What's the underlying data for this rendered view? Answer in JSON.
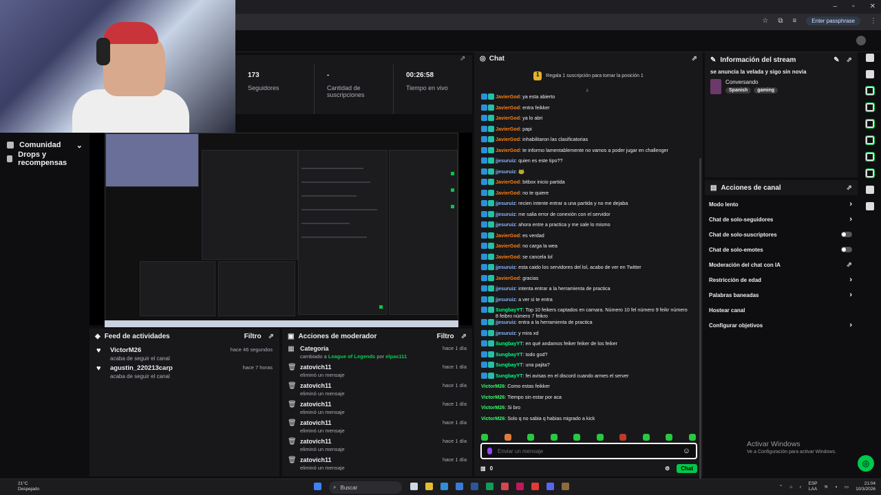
{
  "browser": {
    "passphrase_label": "Enter passphrase",
    "win_min": "–",
    "win_max": "▫",
    "win_close": "✕"
  },
  "leftnav": {
    "items": [
      {
        "label": "Comunidad"
      },
      {
        "label": "Drops y recompensas"
      }
    ]
  },
  "stats": [
    {
      "value": "173",
      "label": "Seguidores"
    },
    {
      "value": "-",
      "label": "Cantidad de suscripciones"
    },
    {
      "value": "00:26:58",
      "label": "Tiempo en vivo"
    }
  ],
  "feed": {
    "title": "Feed de actividades",
    "filter": "Filtro",
    "items": [
      {
        "name": "VictorM26",
        "sub": "acaba de seguir el canal",
        "time": "hace 46 segundos"
      },
      {
        "name": "agustin_220213carp",
        "sub": "acaba de seguir el canal",
        "time": "hace 7 horas"
      }
    ]
  },
  "modactions": {
    "title": "Acciones de moderador",
    "filter": "Filtro",
    "category": {
      "name": "Categoría",
      "pre": "cambiado a",
      "game": "League of Legends",
      "mid": "por",
      "by": "elpas111",
      "time": "hace 1 día"
    },
    "items": [
      {
        "name": "zatovich11",
        "sub": "eliminó un mensaje",
        "time": "hace 1 día"
      },
      {
        "name": "zatovich11",
        "sub": "eliminó un mensaje",
        "time": "hace 1 día"
      },
      {
        "name": "zatovich11",
        "sub": "eliminó un mensaje",
        "time": "hace 1 día"
      },
      {
        "name": "zatovich11",
        "sub": "eliminó un mensaje",
        "time": "hace 1 día"
      },
      {
        "name": "zatovich11",
        "sub": "eliminó un mensaje",
        "time": "hace 1 día"
      },
      {
        "name": "zatovich11",
        "sub": "eliminó un mensaje",
        "time": "hace 1 día"
      }
    ]
  },
  "chat": {
    "title": "Chat",
    "gift_text": "Regala 1 suscripción para tomar la posición 1",
    "gift_rank": "1",
    "input_placeholder": "Enviar un mensaje",
    "points": "0",
    "send_label": "Chat",
    "messages": [
      {
        "user": "JavierGod",
        "cls": "uJ",
        "badges": true,
        "text": ": ya esta abierto"
      },
      {
        "user": "JavierGod",
        "cls": "uJ",
        "badges": true,
        "text": ": entra feikker"
      },
      {
        "user": "JavierGod",
        "cls": "uJ",
        "badges": true,
        "text": ": ya lo abri"
      },
      {
        "user": "JavierGod",
        "cls": "uJ",
        "badges": true,
        "text": ": papi"
      },
      {
        "user": "JavierGod",
        "cls": "uJ",
        "badges": true,
        "text": ": inhabilitaron las clasificatorias"
      },
      {
        "user": "JavierGod",
        "cls": "uJ",
        "badges": true,
        "text": ": te informo lamentablemente no vamos a poder jugar en challenger"
      },
      {
        "user": "jjesuruiz",
        "cls": "uj",
        "badges": true,
        "text": ": quien es este tipo??"
      },
      {
        "user": "jjesuruiz",
        "cls": "uj",
        "badges": true,
        "text": ": 🐸"
      },
      {
        "user": "JavierGod",
        "cls": "uJ",
        "badges": true,
        "text": ": bitbox inicio partida"
      },
      {
        "user": "JavierGod",
        "cls": "uJ",
        "badges": true,
        "text": ": no te quiere"
      },
      {
        "user": "jjesuruiz",
        "cls": "uj",
        "badges": true,
        "text": ": recien intente entrar a una partida y no me dejaba"
      },
      {
        "user": "jjesuruiz",
        "cls": "uj",
        "badges": true,
        "text": ": me salia error de conexión con el servidor"
      },
      {
        "user": "jjesuruiz",
        "cls": "uj",
        "badges": true,
        "text": ": ahora entre a practica y me sale lo mismo"
      },
      {
        "user": "JavierGod",
        "cls": "uJ",
        "badges": true,
        "text": ": es verdad"
      },
      {
        "user": "JavierGod",
        "cls": "uJ",
        "badges": true,
        "text": ": no carga la wea"
      },
      {
        "user": "JavierGod",
        "cls": "uJ",
        "badges": true,
        "text": ": se cancela lol"
      },
      {
        "user": "jjesuruiz",
        "cls": "uj",
        "badges": true,
        "text": ": esta caido los servidores del lol, acabo de ver en Twitter"
      },
      {
        "user": "JavierGod",
        "cls": "uJ",
        "badges": true,
        "text": ": gracias"
      },
      {
        "user": "jjesuruiz",
        "cls": "uj",
        "badges": true,
        "text": ": intenta entrar a la herramienta de practica"
      },
      {
        "user": "jjesuruiz",
        "cls": "uj",
        "badges": true,
        "text": ": a ver si te entra"
      },
      {
        "user": "SungbayYT",
        "cls": "uS",
        "badges": true,
        "text": ": Top 10 feikers captados en camara. Número 10 fel número 9 feikr número 8 feibro número 7 feikro"
      },
      {
        "user": "jjesuruiz",
        "cls": "uj",
        "badges": true,
        "text": ": entra a la herramienta de practica"
      },
      {
        "user": "jjesuruiz",
        "cls": "uj",
        "badges": true,
        "text": ": y mira xd"
      },
      {
        "user": "SungbayYT",
        "cls": "uS",
        "badges": true,
        "text": ": en qué andamos feiker feiker de los feiker"
      },
      {
        "user": "SungbayYT",
        "cls": "uS",
        "badges": true,
        "text": ": todo god?"
      },
      {
        "user": "SungbayYT",
        "cls": "uS",
        "badges": true,
        "text": ": una pajita?"
      },
      {
        "user": "SungbayYT",
        "cls": "uS",
        "badges": true,
        "text": ": fei avisas en el discord cuando armes el server"
      },
      {
        "user": "VictorM26",
        "cls": "uV",
        "badges": false,
        "text": ": Como estas feikker"
      },
      {
        "user": "VictorM26",
        "cls": "uV",
        "badges": false,
        "text": ": Tiempo sin estar por aca"
      },
      {
        "user": "VictorM26",
        "cls": "uV",
        "badges": false,
        "text": ": Si bro"
      },
      {
        "user": "VictorM26",
        "cls": "uV",
        "badges": false,
        "text": ": Solo q no sabia q habias migrado a kick"
      }
    ]
  },
  "info": {
    "title": "Información del stream",
    "stream_title": "se anuncia la velada y sigo sin novia",
    "category": "Conversando",
    "tags": [
      "Spanish",
      "gaming"
    ]
  },
  "actions": {
    "title": "Acciones de canal",
    "items": [
      {
        "label": "Modo lento",
        "ctrl": "chev"
      },
      {
        "label": "Chat de solo-seguidores",
        "ctrl": "chev"
      },
      {
        "label": "Chat de solo-suscriptores",
        "ctrl": "toggle"
      },
      {
        "label": "Chat de solo-emotes",
        "ctrl": "toggle"
      },
      {
        "label": "Moderación del chat con IA",
        "ctrl": "pop"
      },
      {
        "label": "Restricción de edad",
        "ctrl": "chev"
      },
      {
        "label": "Palabras baneadas",
        "ctrl": "chev"
      },
      {
        "label": "Hostear canal",
        "ctrl": "none"
      },
      {
        "label": "Configurar objetivos",
        "ctrl": "chev"
      }
    ]
  },
  "windows": {
    "activate_title": "Activar Windows",
    "activate_sub": "Ve a Configuración para activar Windows."
  },
  "taskbar": {
    "weather_temp": "21°C",
    "weather_desc": "Despejado",
    "search_label": "Buscar",
    "lang": "ESP",
    "region": "LAA",
    "time": "21:04",
    "date": "10/3/2026"
  },
  "colors": {
    "accent_green": "#00c84a",
    "bg": "#0e0e10",
    "panel": "#18181b"
  }
}
